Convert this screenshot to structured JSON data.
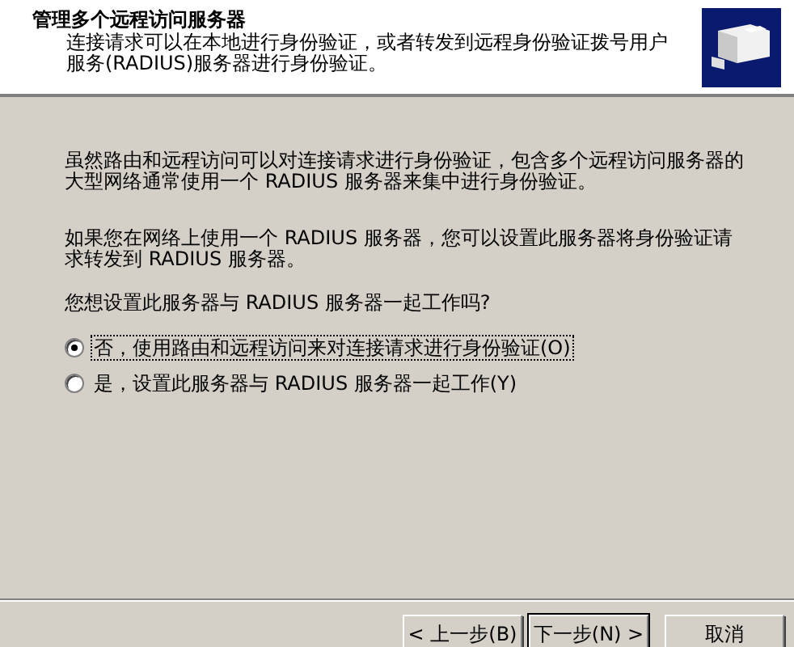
{
  "header": {
    "title": "管理多个远程访问服务器",
    "subtitle": "连接请求可以在本地进行身份验证，或者转发到远程身份验证拨号用户服务(RADIUS)服务器进行身份验证。"
  },
  "paragraphs": [
    "虽然路由和远程访问可以对连接请求进行身份验证，包含多个远程访问服务器的大型网络通常使用一个 RADIUS 服务器来集中进行身份验证。",
    "如果您在网络上使用一个 RADIUS 服务器，您可以设置此服务器将身份验证请求转发到 RADIUS 服务器。"
  ],
  "question": "您想设置此服务器与 RADIUS 服务器一起工作吗?",
  "options": [
    {
      "label": "否，使用路由和远程访问来对连接请求进行身份验证(O)",
      "selected": true,
      "focused": true
    },
    {
      "label": "是，设置此服务器与 RADIUS 服务器一起工作(Y)",
      "selected": false,
      "focused": false
    }
  ],
  "buttons": [
    {
      "label": "< 上一步(B)",
      "default": false
    },
    {
      "label": "下一步(N) >",
      "default": true
    },
    {
      "label": "取消",
      "default": false
    }
  ]
}
